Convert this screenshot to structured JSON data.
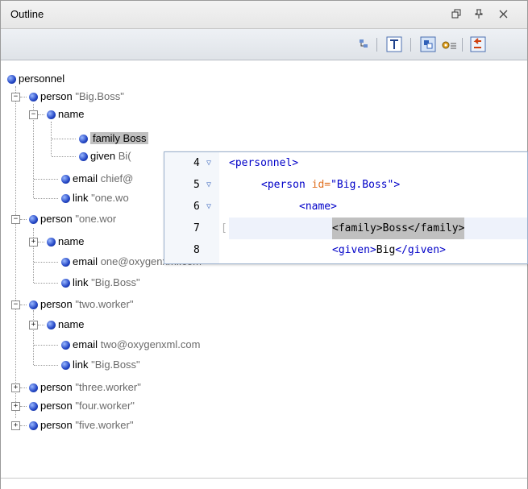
{
  "panel": {
    "title": "Outline"
  },
  "window_buttons": [
    {
      "name": "restore-icon",
      "glyph": "❐"
    },
    {
      "name": "pin-icon",
      "glyph": "⊥"
    },
    {
      "name": "close-icon",
      "glyph": "✕"
    }
  ],
  "tree": {
    "root": "personnel",
    "persons": [
      {
        "tag": "person",
        "value": "\"Big.Boss\""
      },
      {
        "tag": "person",
        "value": "\"one.wor"
      },
      {
        "tag": "person",
        "value": "\"two.worker\""
      },
      {
        "tag": "person",
        "value": "\"three.worker\""
      },
      {
        "tag": "person",
        "value": "\"four.worker\""
      },
      {
        "tag": "person",
        "value": "\"five.worker\""
      }
    ],
    "p1_children": {
      "name": "name",
      "family": "family Boss",
      "given": "given",
      "given_val": "Bi(",
      "email": "email",
      "email_val": "chief@",
      "link": "link",
      "link_val": "\"one.wo"
    },
    "p2_children": {
      "name": "name",
      "email": "email",
      "email_val": "one@oxygenxml.com",
      "link": "link",
      "link_val": "\"Big.Boss\""
    },
    "p3_children": {
      "name": "name",
      "email": "email",
      "email_val": "two@oxygenxml.com",
      "link": "link",
      "link_val": "\"Big.Boss\""
    }
  },
  "popup": {
    "lines": [
      {
        "num": "4",
        "fold": "▽"
      },
      {
        "num": "5",
        "fold": "▽"
      },
      {
        "num": "6",
        "fold": "▽"
      },
      {
        "num": "7",
        "fold": ""
      },
      {
        "num": "8",
        "fold": ""
      }
    ],
    "l4": "<personnel>",
    "l5_open": "<person ",
    "l5_attr": "id=",
    "l5_val": "\"Big.Boss\"",
    "l5_close": ">",
    "l6": "<name>",
    "l7_open": "<family>",
    "l7_text": "Boss",
    "l7_close": "</family>",
    "l8_open": "<given>",
    "l8_text": "Big",
    "l8_close": "</given>"
  }
}
